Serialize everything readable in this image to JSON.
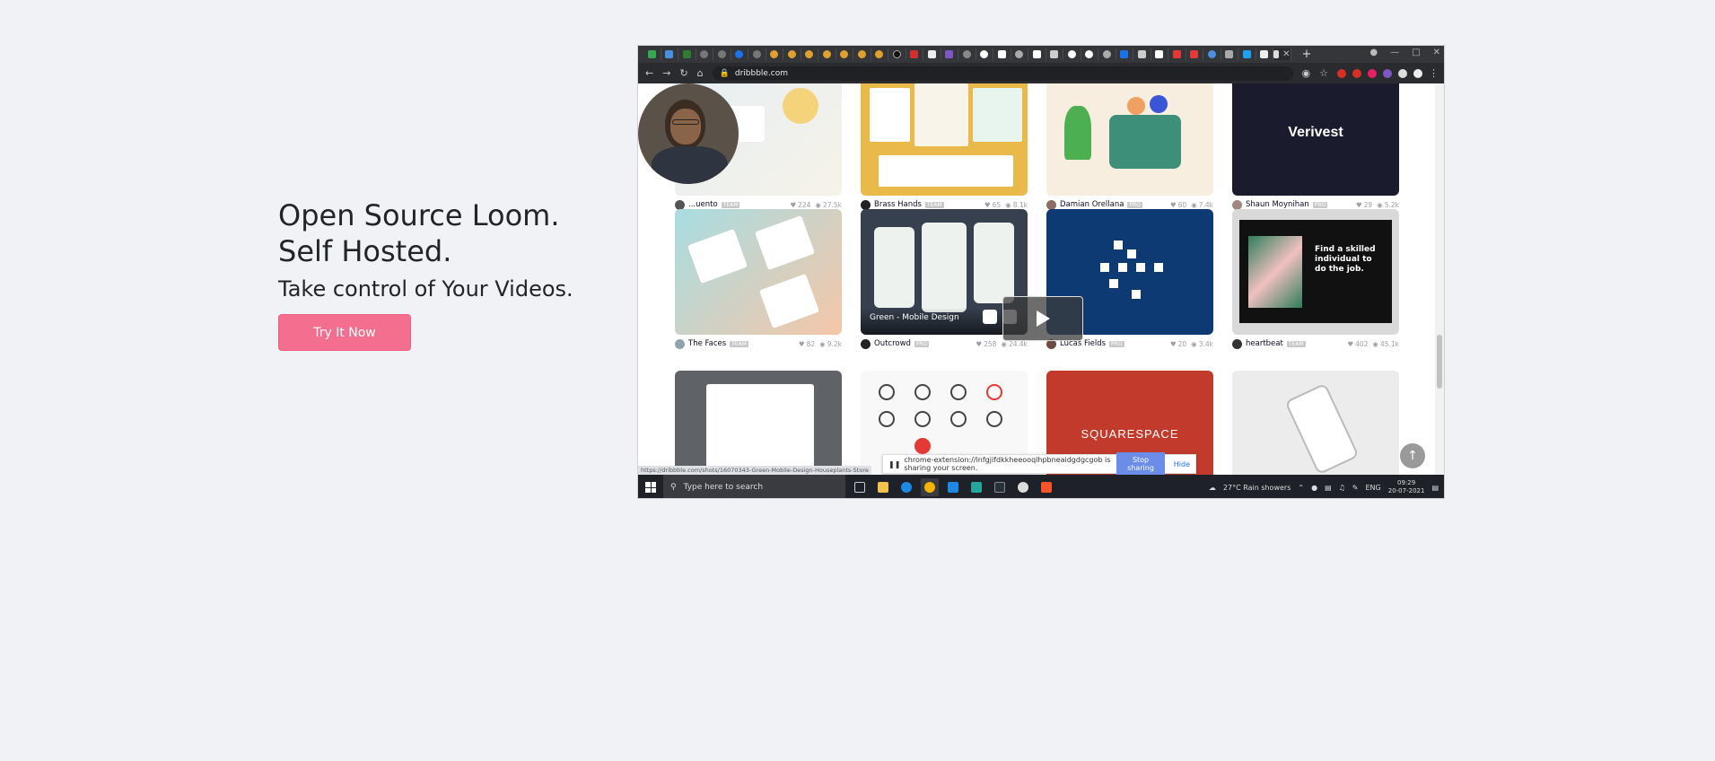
{
  "hero": {
    "title_line1": "Open Source Loom.",
    "title_line2": "Self Hosted.",
    "subtitle": "Take control of Your Videos.",
    "cta_label": "Try It Now"
  },
  "browser": {
    "url": "dribbble.com",
    "status_url": "https://dribbble.com/shots/16070343-Green-Mobile-Design-Houseplants-Store",
    "tab_close": "✕",
    "tab_new": "+"
  },
  "cards": [
    {
      "author": "...uento",
      "badge": "TEAM",
      "likes": "224",
      "views": "27.5k"
    },
    {
      "author": "Brass Hands",
      "badge": "TEAM",
      "likes": "65",
      "views": "8.1k"
    },
    {
      "author": "Damian Orellana",
      "badge": "PRO",
      "likes": "60",
      "views": "7.4k"
    },
    {
      "author": "Shaun Moynihan",
      "badge": "PRO",
      "likes": "29",
      "views": "5.2k"
    },
    {
      "author": "The Faces",
      "badge": "TEAM",
      "likes": "82",
      "views": "9.2k"
    },
    {
      "author": "Outcrowd",
      "badge": "PRO",
      "likes": "258",
      "views": "24.4k",
      "hover_title": "Green - Mobile Design"
    },
    {
      "author": "Lucas Fields",
      "badge": "PRO",
      "likes": "20",
      "views": "3.4k"
    },
    {
      "author": "heartbeat",
      "badge": "TEAM",
      "likes": "402",
      "views": "45.1k"
    }
  ],
  "thumb_texts": {
    "verivest": "Verivest",
    "squarespace": "SQUARESPACE",
    "find_skilled": "Find a skilled individual to do the job."
  },
  "share_bar": {
    "message": "chrome-extension://lnfgjifdkkheeooqlhpbneaidgdgcgob is sharing your screen.",
    "stop_label": "Stop sharing",
    "hide_label": "Hide"
  },
  "taskbar": {
    "search_placeholder": "Type here to search",
    "weather": "27°C  Rain showers",
    "lang": "ENG",
    "time": "09:29",
    "date": "20-07-2021"
  }
}
